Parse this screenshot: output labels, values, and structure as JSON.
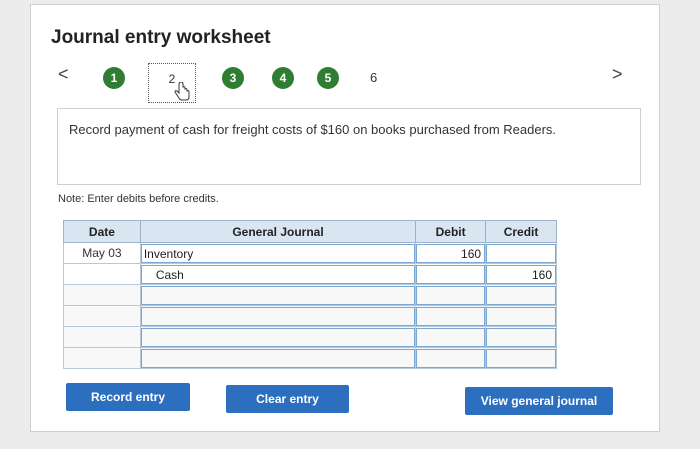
{
  "title": "Journal entry worksheet",
  "nav": {
    "prev": "<",
    "next": ">",
    "steps": [
      "1",
      "2",
      "3",
      "4",
      "5",
      "6"
    ]
  },
  "description": "Record payment of cash for freight costs of $160 on books purchased from Readers.",
  "note": "Note: Enter debits before credits.",
  "table": {
    "headers": {
      "date": "Date",
      "journal": "General Journal",
      "debit": "Debit",
      "credit": "Credit"
    },
    "rows": [
      {
        "date": "May 03",
        "account": "Inventory",
        "debit": "160",
        "credit": ""
      },
      {
        "date": "",
        "account": "Cash",
        "debit": "",
        "credit": "160"
      },
      {
        "date": "",
        "account": "",
        "debit": "",
        "credit": ""
      },
      {
        "date": "",
        "account": "",
        "debit": "",
        "credit": ""
      },
      {
        "date": "",
        "account": "",
        "debit": "",
        "credit": ""
      },
      {
        "date": "",
        "account": "",
        "debit": "",
        "credit": ""
      }
    ]
  },
  "buttons": {
    "record": "Record entry",
    "clear": "Clear entry",
    "view": "View general journal"
  },
  "colors": {
    "step_active": "#2e7d32",
    "button": "#2d6fbf",
    "header": "#d9e6f2"
  }
}
